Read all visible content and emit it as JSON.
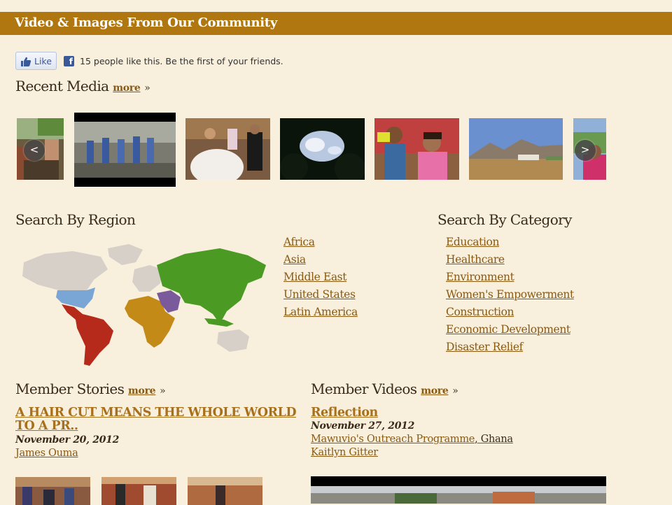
{
  "banner": {
    "title": "Video & Images From Our Community"
  },
  "social": {
    "like_label": "Like",
    "fb_icon": "facebook-icon",
    "like_text": "15 people like this. Be the first of your friends."
  },
  "recent_media": {
    "title": "Recent Media",
    "more_label": "more",
    "raquo": "»",
    "prev_label": "<",
    "next_label": ">",
    "thumbnails": [
      "thumb-1",
      "thumb-2-video",
      "thumb-3",
      "thumb-4",
      "thumb-5",
      "thumb-6",
      "thumb-7"
    ]
  },
  "region": {
    "title": "Search By Region",
    "links": [
      "Africa",
      "Asia",
      "Middle East",
      "United States",
      "Latin America"
    ]
  },
  "category": {
    "title": "Search By Category",
    "links": [
      "Education",
      "Healthcare",
      "Environment",
      "Women's Empowerment",
      "Construction",
      "Economic Development",
      "Disaster Relief"
    ]
  },
  "stories": {
    "title": "Member Stories",
    "more_label": "more",
    "raquo": "»",
    "item_title": "A HAIR CUT MEANS THE WHOLE WORLD TO A PR..",
    "date": "November 20, 2012",
    "author": "James Ouma"
  },
  "videos": {
    "title": "Member Videos",
    "more_label": "more",
    "raquo": "»",
    "item_title": "Reflection",
    "date": "November 27, 2012",
    "org": "Mawuvio's Outreach Programme",
    "location": ", Ghana",
    "author": "Kaitlyn Gitter"
  },
  "colors": {
    "banner": "#b07610",
    "background": "#f8efdd",
    "link": "#8a5a12",
    "africa": "#c48a18",
    "asia": "#4a9a24",
    "middle_east": "#7a5a9a",
    "united_states": "#7aa6d6",
    "latin_america": "#b52a1a",
    "land_other": "#d6d0c8"
  }
}
